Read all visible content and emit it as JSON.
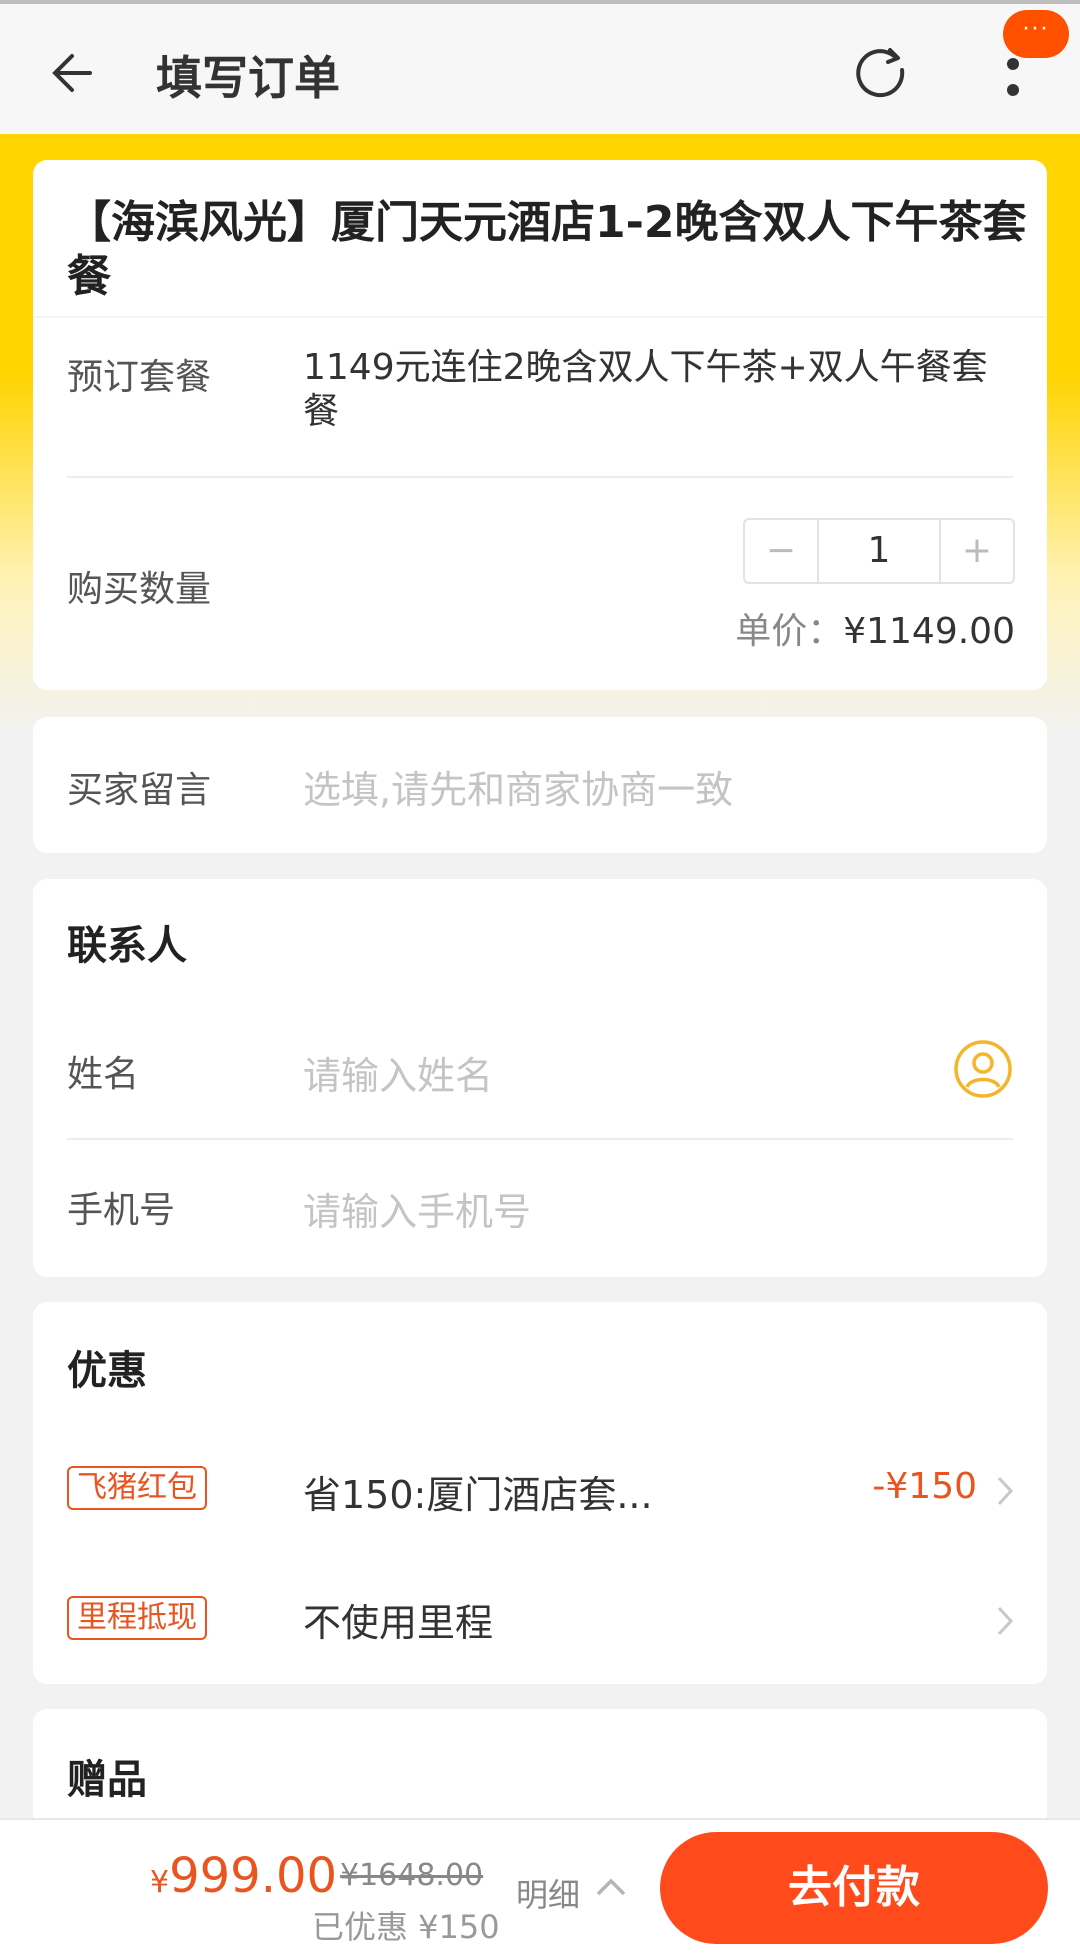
{
  "header": {
    "title": "填写订单",
    "badge_text": "···"
  },
  "product": {
    "title": "【海滨风光】厦门天元酒店1-2晚含双人下午茶套餐",
    "package_label": "预订套餐",
    "package_value": "1149元连住2晚含双人下午茶+双人午餐套餐",
    "quantity_label": "购买数量",
    "quantity": "1",
    "minus": "−",
    "plus": "+",
    "unit_price_label": "单价：",
    "unit_price": "¥1149.00"
  },
  "message": {
    "label": "买家留言",
    "placeholder": "选填,请先和商家协商一致"
  },
  "contact": {
    "title": "联系人",
    "name_label": "姓名",
    "name_placeholder": "请输入姓名",
    "phone_label": "手机号",
    "phone_placeholder": "请输入手机号"
  },
  "discount": {
    "title": "优惠",
    "items": [
      {
        "tag": "飞猪红包",
        "text": "省150:厦门酒店套...",
        "amount": "-¥150"
      },
      {
        "tag": "里程抵现",
        "text": "不使用里程",
        "amount": ""
      }
    ]
  },
  "gift": {
    "title": "赠品"
  },
  "footer": {
    "currency": "¥",
    "price": "999.00",
    "original_price": "¥1648.00",
    "saved": "已优惠 ¥150",
    "detail_label": "明细",
    "pay_label": "去付款"
  },
  "colors": {
    "accent": "#ff5000",
    "price": "#e9541f",
    "banner": "#ffd400"
  }
}
